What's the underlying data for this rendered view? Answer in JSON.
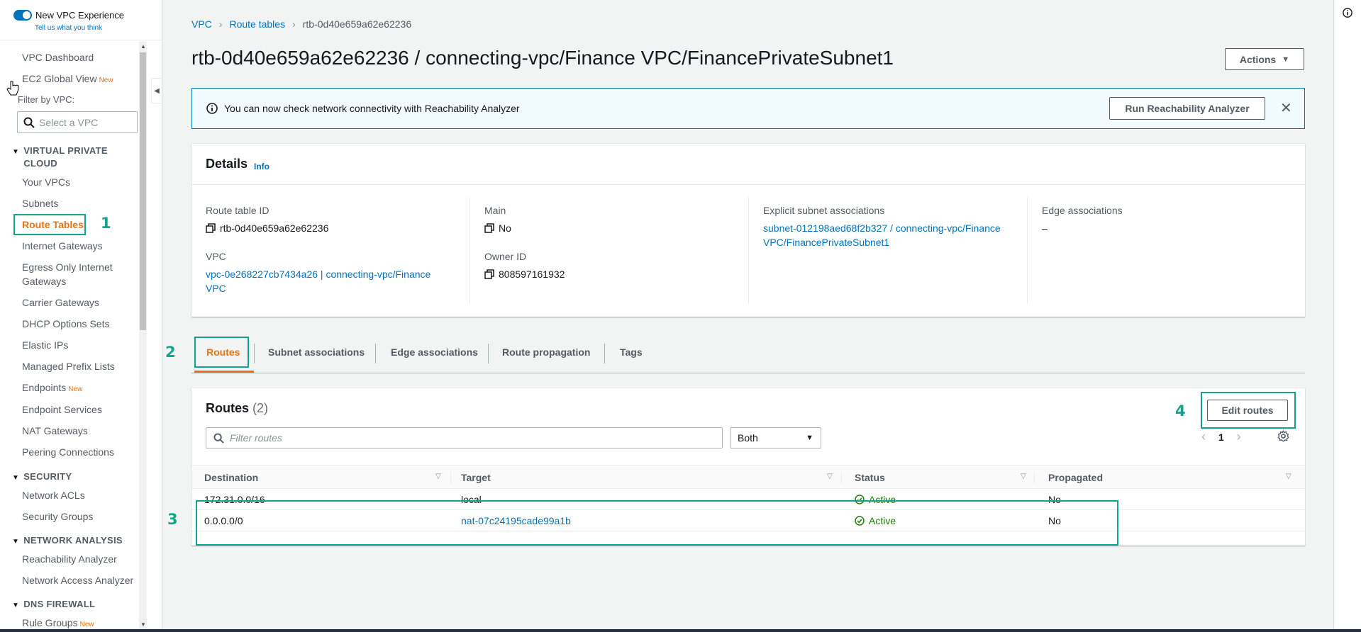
{
  "sidebar": {
    "toggle_label": "New VPC Experience",
    "feedback_link": "Tell us what you think",
    "filter_label": "Filter by VPC:",
    "vpc_select_placeholder": "Select a VPC",
    "new_badge": "New",
    "items": {
      "dashboard": "VPC Dashboard",
      "ec2_global_view": "EC2 Global View",
      "your_vpcs": "Your VPCs",
      "subnets": "Subnets",
      "route_tables": "Route Tables",
      "internet_gateways": "Internet Gateways",
      "egress_only": "Egress Only Internet Gateways",
      "carrier_gateways": "Carrier Gateways",
      "dhcp_options": "DHCP Options Sets",
      "elastic_ips": "Elastic IPs",
      "prefix_lists": "Managed Prefix Lists",
      "endpoints": "Endpoints",
      "endpoint_services": "Endpoint Services",
      "nat_gateways": "NAT Gateways",
      "peering": "Peering Connections",
      "network_acls": "Network ACLs",
      "security_groups": "Security Groups",
      "reachability_analyzer": "Reachability Analyzer",
      "network_access_analyzer": "Network Access Analyzer",
      "rule_groups": "Rule Groups"
    },
    "sections": {
      "vpc": "VIRTUAL PRIVATE CLOUD",
      "security": "SECURITY",
      "network_analysis": "NETWORK ANALYSIS",
      "dns_firewall": "DNS FIREWALL"
    }
  },
  "annotations": [
    "1",
    "2",
    "3",
    "4"
  ],
  "breadcrumb": [
    "VPC",
    "Route tables",
    "rtb-0d40e659a62e62236"
  ],
  "page_title": "rtb-0d40e659a62e62236 / connecting-vpc/Finance VPC/FinancePrivateSubnet1",
  "actions_label": "Actions",
  "flash": {
    "message": "You can now check network connectivity with Reachability Analyzer",
    "button": "Run Reachability Analyzer"
  },
  "details": {
    "title": "Details",
    "info": "Info",
    "route_table_id_label": "Route table ID",
    "route_table_id": "rtb-0d40e659a62e62236",
    "vpc_label": "VPC",
    "vpc_value": "vpc-0e268227cb7434a26 | connecting-vpc/Finance VPC",
    "main_label": "Main",
    "main_value": "No",
    "owner_label": "Owner ID",
    "owner_value": "808597161932",
    "explicit_label": "Explicit subnet associations",
    "explicit_value": "subnet-012198aed68f2b327 / connecting-vpc/Finance VPC/FinancePrivateSubnet1",
    "edge_label": "Edge associations",
    "edge_value": "–"
  },
  "tabs": [
    "Routes",
    "Subnet associations",
    "Edge associations",
    "Route propagation",
    "Tags"
  ],
  "routes": {
    "title": "Routes",
    "count": "(2)",
    "edit_button": "Edit routes",
    "filter_placeholder": "Filter routes",
    "select_value": "Both",
    "page": "1",
    "columns": [
      "Destination",
      "Target",
      "Status",
      "Propagated"
    ],
    "rows": [
      {
        "destination": "172.31.0.0/16",
        "target": "local",
        "status": "Active",
        "propagated": "No"
      },
      {
        "destination": "0.0.0.0/0",
        "target": "nat-07c24195cade99a1b",
        "status": "Active",
        "propagated": "No"
      }
    ]
  },
  "colors": {
    "accent_orange": "#ec7211",
    "link_blue": "#0073bb",
    "annotation_teal": "#12a58b",
    "status_green": "#1d8102"
  }
}
